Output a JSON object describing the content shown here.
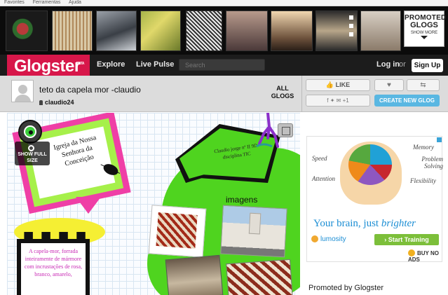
{
  "browser": {
    "favorites_label": "Favorites",
    "favorites_item": "Ferramentas",
    "help_label": "Ajuda"
  },
  "promo": {
    "line1": "PROMOTED",
    "line2": "GLOGS",
    "line3": "SHOW MORE"
  },
  "nav": {
    "logo": "Glogster",
    "logo_sub": "BETA",
    "explore": "Explore",
    "live_pulse": "Live Pulse",
    "search_placeholder": "Search",
    "login": "Log in",
    "or": "or",
    "signup": "Sign Up"
  },
  "glog": {
    "title": "teto da capela mor -claudio",
    "author": "claudio24",
    "all_glogs": "ALL GLOGS",
    "like": "LIKE",
    "create_new": "CREATE NEW GLOG",
    "share_icons": "f  ✦  ✉  +1"
  },
  "canvas": {
    "show_full_size": "SHOW FULL SIZE",
    "card_text": "Igreja da Nossa Senhora da Conceição",
    "speech_text": "Claudio jorge nº II 9D disciplina TIC",
    "imagens": "imagens",
    "castle_text": "A capela-mor, forrada inteiramente de mármore com incrustações de rosa, branco, amarelo,"
  },
  "ad": {
    "label_speed": "Speed",
    "label_attention": "Attention",
    "label_memory": "Memory",
    "label_problem": "Problem Solving",
    "label_flexibility": "Flexibility",
    "headline_prefix": "Your brain, just ",
    "headline_emph": "brighter",
    "brand": "lumosity",
    "cta": "› Start Training",
    "buy_no_ads": "BUY NO ADS"
  },
  "footer": {
    "promoted_by": "Promoted by Glogster"
  },
  "colors": {
    "brand_red": "#d7174a",
    "create_blue": "#59b7e2",
    "lumosity_blue": "#1c8ed4",
    "canvas_green": "#4fd41f"
  }
}
